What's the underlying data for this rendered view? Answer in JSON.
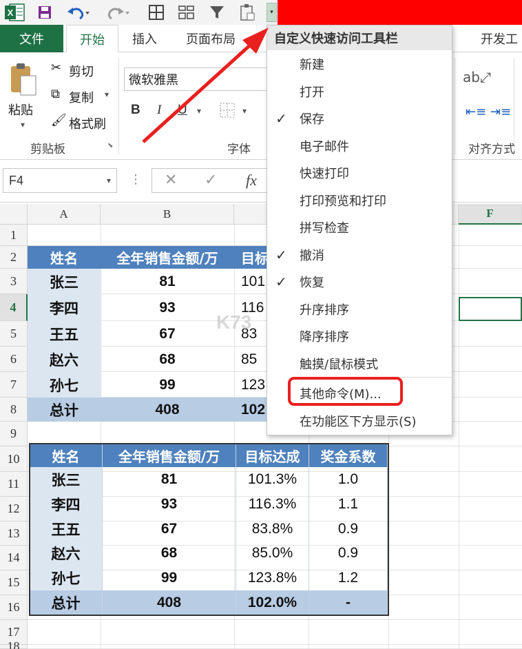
{
  "qat": {
    "excel_icon": "excel-logo-icon",
    "dropdown_glyph": "▾"
  },
  "tabs": {
    "file": "文件",
    "home": "开始",
    "insert": "插入",
    "page_layout": "页面布局",
    "developer": "开发工"
  },
  "ribbon": {
    "paste": "粘贴",
    "cut": "剪切",
    "copy": "复制",
    "format_painter": "格式刷",
    "clipboard_group": "剪贴板",
    "font_name": "微软雅黑",
    "bold": "B",
    "italic": "I",
    "underline": "U",
    "font_group": "字体",
    "align_group": "对齐方式"
  },
  "formula_bar": {
    "name_box": "F4",
    "fx": "fx"
  },
  "grid": {
    "col_headers": [
      "A",
      "B",
      "F"
    ],
    "row_headers": [
      "1",
      "2",
      "3",
      "4",
      "5",
      "6",
      "7",
      "8",
      "9",
      "10",
      "11",
      "12",
      "13",
      "14",
      "15",
      "16",
      "17",
      "18"
    ]
  },
  "table1": {
    "headers": [
      "姓名",
      "全年销售金额/万",
      "目标"
    ],
    "rows": [
      [
        "张三",
        "81",
        "101"
      ],
      [
        "李四",
        "93",
        "116"
      ],
      [
        "王五",
        "67",
        "83"
      ],
      [
        "赵六",
        "68",
        "85"
      ],
      [
        "孙七",
        "99",
        "123"
      ]
    ],
    "total": [
      "总计",
      "408",
      "102"
    ]
  },
  "table2": {
    "headers": [
      "姓名",
      "全年销售金额/万",
      "目标达成",
      "奖金系数"
    ],
    "rows": [
      [
        "张三",
        "81",
        "101.3%",
        "1.0"
      ],
      [
        "李四",
        "93",
        "116.3%",
        "1.1"
      ],
      [
        "王五",
        "67",
        "83.8%",
        "0.9"
      ],
      [
        "赵六",
        "68",
        "85.0%",
        "0.9"
      ],
      [
        "孙七",
        "99",
        "123.8%",
        "1.2"
      ]
    ],
    "total": [
      "总计",
      "408",
      "102.0%",
      "-"
    ]
  },
  "menu": {
    "title": "自定义快速访问工具栏",
    "items": [
      {
        "label": "新建",
        "checked": ""
      },
      {
        "label": "打开",
        "checked": ""
      },
      {
        "label": "保存",
        "checked": "✓"
      },
      {
        "label": "电子邮件",
        "checked": ""
      },
      {
        "label": "快速打印",
        "checked": ""
      },
      {
        "label": "打印预览和打印",
        "checked": ""
      },
      {
        "label": "拼写检查",
        "checked": ""
      },
      {
        "label": "撤消",
        "checked": "✓"
      },
      {
        "label": "恢复",
        "checked": "✓"
      },
      {
        "label": "升序排序",
        "checked": ""
      },
      {
        "label": "降序排序",
        "checked": ""
      },
      {
        "label": "触摸/鼠标模式",
        "checked": ""
      }
    ],
    "more_commands": "其他命令(M)...",
    "show_below": "在功能区下方显示(S)"
  },
  "watermark": "K73",
  "colors": {
    "excel_green": "#1e7145",
    "table_header": "#4e81bd",
    "name_fill": "#dce6f1",
    "total_fill": "#b8cce4",
    "highlight": "#e8201e",
    "arrow": "#e8201e"
  }
}
